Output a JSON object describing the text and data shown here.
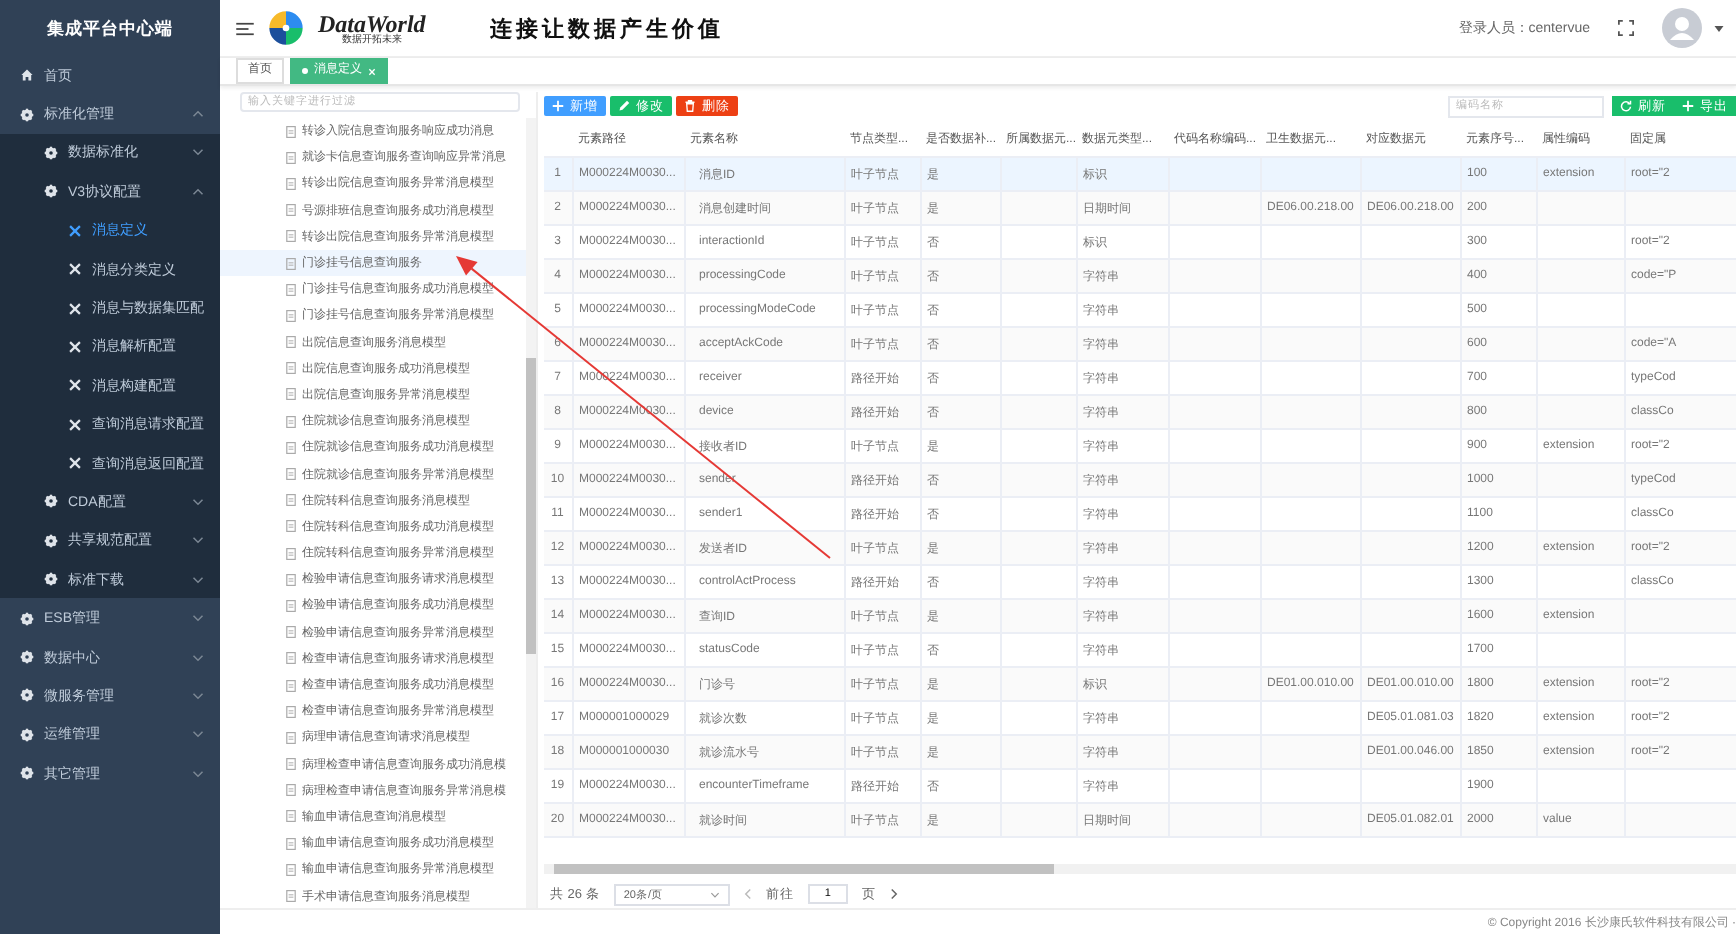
{
  "sidebar": {
    "title": "集成平台中心端",
    "items": [
      {
        "kind": "home",
        "label": "首页",
        "selected": false
      },
      {
        "kind": "group",
        "label": "标准化管理",
        "expanded": true,
        "selected": false,
        "children": [
          {
            "kind": "group",
            "label": "数据标准化",
            "expanded": false,
            "selected": false
          },
          {
            "kind": "group",
            "label": "V3协议配置",
            "expanded": true,
            "selected": false,
            "children": [
              {
                "kind": "page",
                "label": "消息定义",
                "selected": true
              },
              {
                "kind": "page",
                "label": "消息分类定义",
                "selected": false
              },
              {
                "kind": "page",
                "label": "消息与数据集匹配",
                "selected": false
              },
              {
                "kind": "page",
                "label": "消息解析配置",
                "selected": false
              },
              {
                "kind": "page",
                "label": "消息构建配置",
                "selected": false
              },
              {
                "kind": "page",
                "label": "查询消息请求配置",
                "selected": false
              },
              {
                "kind": "page",
                "label": "查询消息返回配置",
                "selected": false
              }
            ]
          },
          {
            "kind": "group",
            "label": "CDA配置",
            "expanded": false,
            "selected": false
          },
          {
            "kind": "group",
            "label": "共享规范配置",
            "expanded": false,
            "selected": false
          },
          {
            "kind": "group",
            "label": "标准下载",
            "expanded": false,
            "selected": false
          }
        ]
      },
      {
        "kind": "group",
        "label": "ESB管理",
        "expanded": false,
        "selected": false
      },
      {
        "kind": "group",
        "label": "数据中心",
        "expanded": false,
        "selected": false
      },
      {
        "kind": "group",
        "label": "微服务管理",
        "expanded": false,
        "selected": false
      },
      {
        "kind": "group",
        "label": "运维管理",
        "expanded": false,
        "selected": false
      },
      {
        "kind": "group",
        "label": "其它管理",
        "expanded": false,
        "selected": false
      }
    ]
  },
  "header": {
    "brand": "DataWorld",
    "brand_subtitle": "数据开拓未来",
    "slogan": "连接让数据产生价值",
    "user_label": "登录人员：centervue"
  },
  "tabs": [
    {
      "label": "首页",
      "selected": false,
      "closable": false
    },
    {
      "label": "消息定义",
      "selected": true,
      "closable": true
    }
  ],
  "tree": {
    "placeholder": "输入关键字进行过滤",
    "items": [
      {
        "label": "转诊入院信息查询服务响应成功消息",
        "selected": false
      },
      {
        "label": "就诊卡信息查询服务查询响应异常消息",
        "selected": false
      },
      {
        "label": "转诊出院信息查询服务异常消息模型",
        "selected": false
      },
      {
        "label": "号源排班信息查询服务成功消息模型",
        "selected": false
      },
      {
        "label": "转诊出院信息查询服务异常消息模型",
        "selected": false
      },
      {
        "label": "门诊挂号信息查询服务",
        "selected": true
      },
      {
        "label": "门诊挂号信息查询服务成功消息模型",
        "selected": false
      },
      {
        "label": "门诊挂号信息查询服务异常消息模型",
        "selected": false
      },
      {
        "label": "出院信息查询服务消息模型",
        "selected": false
      },
      {
        "label": "出院信息查询服务成功消息模型",
        "selected": false
      },
      {
        "label": "出院信息查询服务异常消息模型",
        "selected": false
      },
      {
        "label": "住院就诊信息查询服务消息模型",
        "selected": false
      },
      {
        "label": "住院就诊信息查询服务成功消息模型",
        "selected": false
      },
      {
        "label": "住院就诊信息查询服务异常消息模型",
        "selected": false
      },
      {
        "label": "住院转科信息查询服务消息模型",
        "selected": false
      },
      {
        "label": "住院转科信息查询服务成功消息模型",
        "selected": false
      },
      {
        "label": "住院转科信息查询服务异常消息模型",
        "selected": false
      },
      {
        "label": "检验申请信息查询服务请求消息模型",
        "selected": false
      },
      {
        "label": "检验申请信息查询服务成功消息模型",
        "selected": false
      },
      {
        "label": "检验申请信息查询服务异常消息模型",
        "selected": false
      },
      {
        "label": "检查申请信息查询服务请求消息模型",
        "selected": false
      },
      {
        "label": "检查申请信息查询服务成功消息模型",
        "selected": false
      },
      {
        "label": "检查申请信息查询服务异常消息模型",
        "selected": false
      },
      {
        "label": "病理申请信息查询请求消息模型",
        "selected": false
      },
      {
        "label": "病理检查申请信息查询服务成功消息模",
        "selected": false
      },
      {
        "label": "病理检查申请信息查询服务异常消息模",
        "selected": false
      },
      {
        "label": "输血申请信息查询消息模型",
        "selected": false
      },
      {
        "label": "输血申请信息查询服务成功消息模型",
        "selected": false
      },
      {
        "label": "输血申请信息查询服务异常消息模型",
        "selected": false
      },
      {
        "label": "手术申请信息查询服务消息模型",
        "selected": false
      }
    ]
  },
  "toolbar": {
    "buttons": [
      {
        "kind": "add",
        "label": "新增"
      },
      {
        "kind": "edit",
        "label": "修改"
      },
      {
        "kind": "delete",
        "label": "删除"
      }
    ],
    "search_placeholder": "编码名称",
    "actions": [
      {
        "kind": "refresh",
        "label": "刷新"
      },
      {
        "kind": "export",
        "label": "导出"
      }
    ]
  },
  "table": {
    "columns": [
      "元素路径",
      "元素名称",
      "节点类型...",
      "是否数据补...",
      "所属数据元...",
      "数据元类型...",
      "代码名称编码...",
      "卫生数据元...",
      "对应数据元",
      "元素序号...",
      "属性编码",
      "固定属"
    ],
    "rows": [
      {
        "selected": true,
        "no": "1",
        "cells": [
          "M000224M0030...",
          "消息ID",
          "叶子节点",
          "是",
          null,
          "标识",
          null,
          null,
          null,
          "100",
          "extension",
          "root=\"2"
        ]
      },
      {
        "selected": false,
        "no": "2",
        "cells": [
          "M000224M0030...",
          "消息创建时间",
          "叶子节点",
          "是",
          null,
          "日期时间",
          null,
          "DE06.00.218.00",
          "DE06.00.218.00",
          "200",
          null,
          null
        ]
      },
      {
        "selected": false,
        "no": "3",
        "cells": [
          "M000224M0030...",
          "interactionId",
          "叶子节点",
          "否",
          null,
          "标识",
          null,
          null,
          null,
          "300",
          null,
          "root=\"2"
        ]
      },
      {
        "selected": false,
        "no": "4",
        "cells": [
          "M000224M0030...",
          "processingCode",
          "叶子节点",
          "否",
          null,
          "字符串",
          null,
          null,
          null,
          "400",
          null,
          "code=\"P"
        ]
      },
      {
        "selected": false,
        "no": "5",
        "cells": [
          "M000224M0030...",
          "processingModeCode",
          "叶子节点",
          "否",
          null,
          "字符串",
          null,
          null,
          null,
          "500",
          null,
          null
        ]
      },
      {
        "selected": false,
        "no": "6",
        "cells": [
          "M000224M0030...",
          "acceptAckCode",
          "叶子节点",
          "否",
          null,
          "字符串",
          null,
          null,
          null,
          "600",
          null,
          "code=\"A"
        ]
      },
      {
        "selected": false,
        "no": "7",
        "cells": [
          "M000224M0030...",
          "receiver",
          "路径开始",
          "否",
          null,
          "字符串",
          null,
          null,
          null,
          "700",
          null,
          "typeCod"
        ]
      },
      {
        "selected": false,
        "no": "8",
        "cells": [
          "M000224M0030...",
          "device",
          "路径开始",
          "否",
          null,
          "字符串",
          null,
          null,
          null,
          "800",
          null,
          "classCo"
        ]
      },
      {
        "selected": false,
        "no": "9",
        "cells": [
          "M000224M0030...",
          "接收者ID",
          "叶子节点",
          "是",
          null,
          "字符串",
          null,
          null,
          null,
          "900",
          "extension",
          "root=\"2"
        ]
      },
      {
        "selected": false,
        "no": "10",
        "cells": [
          "M000224M0030...",
          "sender",
          "路径开始",
          "否",
          null,
          "字符串",
          null,
          null,
          null,
          "1000",
          null,
          "typeCod"
        ]
      },
      {
        "selected": false,
        "no": "11",
        "cells": [
          "M000224M0030...",
          "sender1",
          "路径开始",
          "否",
          null,
          "字符串",
          null,
          null,
          null,
          "1100",
          null,
          "classCo"
        ]
      },
      {
        "selected": false,
        "no": "12",
        "cells": [
          "M000224M0030...",
          "发送者ID",
          "叶子节点",
          "是",
          null,
          "字符串",
          null,
          null,
          null,
          "1200",
          "extension",
          "root=\"2"
        ]
      },
      {
        "selected": false,
        "no": "13",
        "cells": [
          "M000224M0030...",
          "controlActProcess",
          "路径开始",
          "否",
          null,
          "字符串",
          null,
          null,
          null,
          "1300",
          null,
          "classCo"
        ]
      },
      {
        "selected": false,
        "no": "14",
        "cells": [
          "M000224M0030...",
          "查询ID",
          "叶子节点",
          "是",
          null,
          "字符串",
          null,
          null,
          null,
          "1600",
          "extension",
          null
        ]
      },
      {
        "selected": false,
        "no": "15",
        "cells": [
          "M000224M0030...",
          "statusCode",
          "叶子节点",
          "否",
          null,
          "字符串",
          null,
          null,
          null,
          "1700",
          null,
          null
        ]
      },
      {
        "selected": false,
        "no": "16",
        "cells": [
          "M000224M0030...",
          "门诊号",
          "叶子节点",
          "是",
          null,
          "标识",
          null,
          "DE01.00.010.00",
          "DE01.00.010.00",
          "1800",
          "extension",
          "root=\"2"
        ]
      },
      {
        "selected": false,
        "no": "17",
        "cells": [
          "M000001000029",
          "就诊次数",
          "叶子节点",
          "是",
          null,
          "字符串",
          null,
          null,
          "DE05.01.081.03",
          "1820",
          "extension",
          "root=\"2"
        ]
      },
      {
        "selected": false,
        "no": "18",
        "cells": [
          "M000001000030",
          "就诊流水号",
          "叶子节点",
          "是",
          null,
          "字符串",
          null,
          null,
          "DE01.00.046.00",
          "1850",
          "extension",
          "root=\"2"
        ]
      },
      {
        "selected": false,
        "no": "19",
        "cells": [
          "M000224M0030...",
          "encounterTimeframe",
          "路径开始",
          "否",
          null,
          "字符串",
          null,
          null,
          null,
          "1900",
          null,
          null
        ]
      },
      {
        "selected": false,
        "no": "20",
        "cells": [
          "M000224M0030...",
          "就诊时间",
          "叶子节点",
          "是",
          null,
          "日期时间",
          null,
          null,
          "DE05.01.082.01",
          "2000",
          "value",
          null
        ]
      }
    ]
  },
  "pagination": {
    "total": "共 26 条",
    "page_size": "20条/页",
    "goto": "前往",
    "page": "1",
    "page_suffix": "页"
  },
  "footer": {
    "copyright": "© Copyright 2016 长沙康氏软件科技有限公司 ·"
  }
}
